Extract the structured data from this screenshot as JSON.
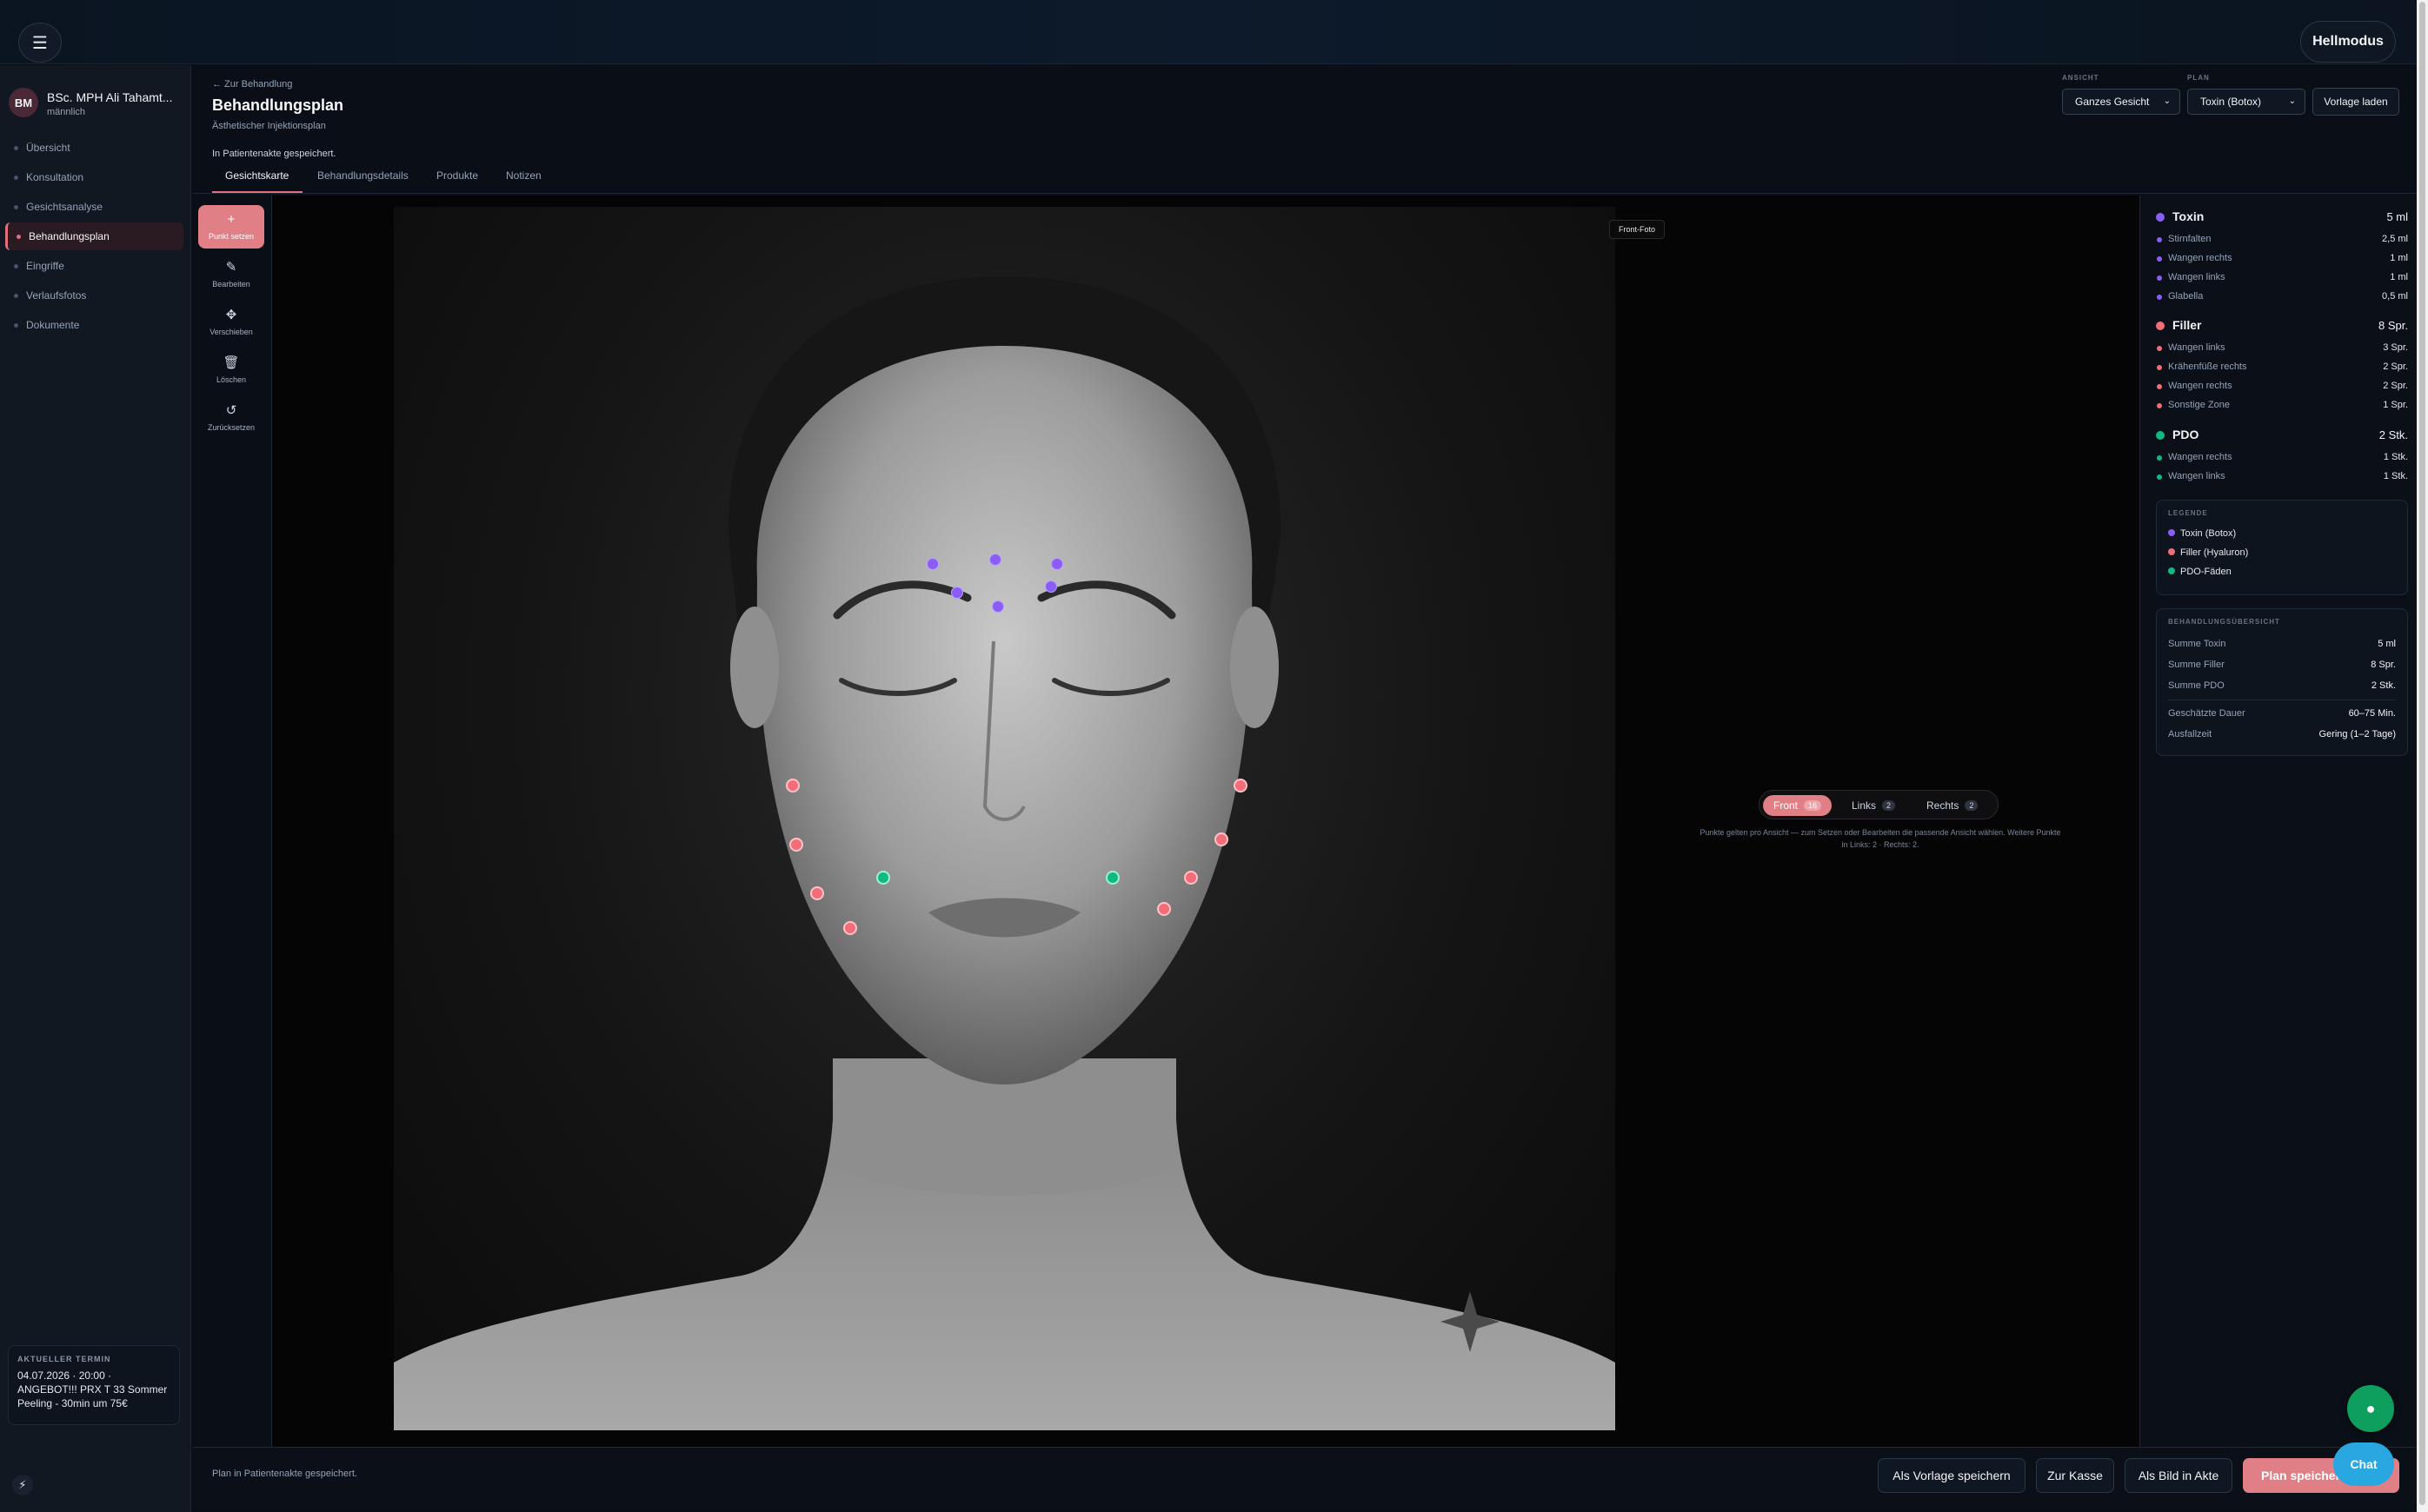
{
  "topbar": {
    "menu_icon": "hamburger-icon",
    "theme_button": "Hellmodus"
  },
  "patient": {
    "initials": "BM",
    "name": "BSc. MPH Ali Tahamt...",
    "gender": "männlich"
  },
  "nav": [
    {
      "label": "Übersicht",
      "active": false
    },
    {
      "label": "Konsultation",
      "active": false
    },
    {
      "label": "Gesichtsanalyse",
      "active": false
    },
    {
      "label": "Behandlungsplan",
      "active": true
    },
    {
      "label": "Eingriffe",
      "active": false
    },
    {
      "label": "Verlaufsfotos",
      "active": false
    },
    {
      "label": "Dokumente",
      "active": false
    }
  ],
  "appointment": {
    "label": "AKTUELLER TERMIN",
    "datetime": "04.07.2026 · 20:00 ·",
    "text": "ANGEBOT!!! PRX T 33 Sommer Peeling - 30min um 75€"
  },
  "header": {
    "back": "← Zur Behandlung",
    "title": "Behandlungsplan",
    "subtitle": "Ästhetischer Injektionsplan",
    "view_label": "ANSICHT",
    "view_value": "Ganzes Gesicht",
    "plan_label": "PLAN",
    "plan_value": "Toxin (Botox)",
    "template_button": "Vorlage laden",
    "saved_status": "In Patientenakte gespeichert."
  },
  "tabs": [
    {
      "label": "Gesichtskarte",
      "active": true
    },
    {
      "label": "Behandlungsdetails",
      "active": false
    },
    {
      "label": "Produkte",
      "active": false
    },
    {
      "label": "Notizen",
      "active": false
    }
  ],
  "tools": [
    {
      "label": "Punkt setzen",
      "icon": "plus-icon",
      "glyph": "+",
      "primary": true
    },
    {
      "label": "Bearbeiten",
      "icon": "pencil-icon",
      "glyph": "✎",
      "primary": false
    },
    {
      "label": "Verschieben",
      "icon": "move-icon",
      "glyph": "✥",
      "primary": false
    },
    {
      "label": "Löschen",
      "icon": "trash-icon",
      "glyph": "🗑",
      "primary": false
    },
    {
      "label": "Zurücksetzen",
      "icon": "reset-icon",
      "glyph": "↺",
      "primary": false
    }
  ],
  "canvas": {
    "photo_label": "Front-Foto",
    "views": [
      {
        "label": "Front",
        "count": "16",
        "active": true
      },
      {
        "label": "Links",
        "count": "2",
        "active": false
      },
      {
        "label": "Rechts",
        "count": "2",
        "active": false
      }
    ],
    "hint": "Punkte gelten pro Ansicht — zum Setzen oder Bearbeiten die passende Ansicht wählen. Weitere Punkte in Links: 2 · Rechts: 2."
  },
  "colors": {
    "toxin": "#8b5cf6",
    "filler": "#f26d78",
    "pdo": "#10b981",
    "accent": "#e07f86"
  },
  "groups": [
    {
      "name": "Toxin",
      "total": "5 ml",
      "color": "#8b5cf6",
      "rows": [
        {
          "name": "Stirnfalten",
          "value": "2,5 ml"
        },
        {
          "name": "Wangen rechts",
          "value": "1 ml"
        },
        {
          "name": "Wangen links",
          "value": "1 ml"
        },
        {
          "name": "Glabella",
          "value": "0,5 ml"
        }
      ]
    },
    {
      "name": "Filler",
      "total": "8 Spr.",
      "color": "#f26d78",
      "rows": [
        {
          "name": "Wangen links",
          "value": "3 Spr."
        },
        {
          "name": "Krähenfüße rechts",
          "value": "2 Spr."
        },
        {
          "name": "Wangen rechts",
          "value": "2 Spr."
        },
        {
          "name": "Sonstige Zone",
          "value": "1 Spr."
        }
      ]
    },
    {
      "name": "PDO",
      "total": "2 Stk.",
      "color": "#10b981",
      "rows": [
        {
          "name": "Wangen rechts",
          "value": "1 Stk."
        },
        {
          "name": "Wangen links",
          "value": "1 Stk."
        }
      ]
    }
  ],
  "legend": {
    "label": "LEGENDE",
    "items": [
      {
        "name": "Toxin (Botox)",
        "color": "#8b5cf6"
      },
      {
        "name": "Filler (Hyaluron)",
        "color": "#f26d78"
      },
      {
        "name": "PDO-Fäden",
        "color": "#10b981"
      }
    ]
  },
  "overview": {
    "label": "BEHANDLUNGSÜBERSICHT",
    "rows": [
      {
        "name": "Summe Toxin",
        "value": "5 ml"
      },
      {
        "name": "Summe Filler",
        "value": "8 Spr."
      },
      {
        "name": "Summe PDO",
        "value": "2 Stk."
      },
      {
        "name": "Geschätzte Dauer",
        "value": "60–75 Min."
      },
      {
        "name": "Ausfallzeit",
        "value": "Gering (1–2 Tage)"
      }
    ]
  },
  "footer": {
    "status": "Plan in Patientenakte gespeichert.",
    "buttons": [
      "Als Vorlage speichern",
      "Zur Kasse",
      "Als Bild in Akte",
      "Plan speichern"
    ]
  },
  "chat": {
    "label": "Chat",
    "icon": "chat-bubble-icon"
  }
}
